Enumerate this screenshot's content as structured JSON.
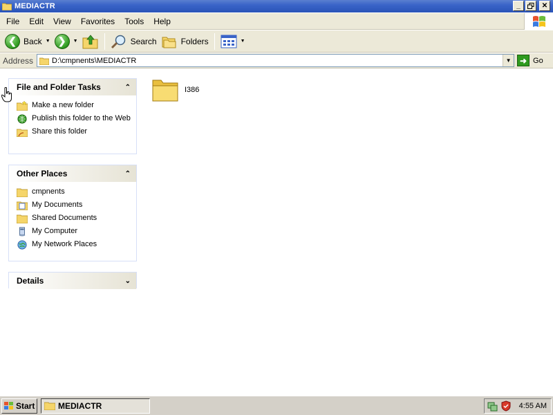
{
  "window": {
    "title": "MEDIACTR",
    "controls": [
      "minimize-icon",
      "restore-icon",
      "close-icon"
    ]
  },
  "menubar": {
    "items": [
      "File",
      "Edit",
      "View",
      "Favorites",
      "Tools",
      "Help"
    ]
  },
  "toolbar": {
    "back_label": "Back",
    "search_label": "Search",
    "folders_label": "Folders"
  },
  "address": {
    "label": "Address",
    "value": "D:\\cmpnents\\MEDIACTR",
    "go_label": "Go"
  },
  "tasks_panel": {
    "title": "File and Folder Tasks",
    "items": [
      {
        "label": "Make a new folder",
        "icon": "new-folder-icon"
      },
      {
        "label": "Publish this folder to the Web",
        "icon": "publish-web-icon"
      },
      {
        "label": "Share this folder",
        "icon": "share-folder-icon"
      }
    ]
  },
  "places_panel": {
    "title": "Other Places",
    "items": [
      {
        "label": "cmpnents",
        "icon": "folder-icon"
      },
      {
        "label": "My Documents",
        "icon": "my-documents-icon"
      },
      {
        "label": "Shared Documents",
        "icon": "folder-icon"
      },
      {
        "label": "My Computer",
        "icon": "my-computer-icon"
      },
      {
        "label": "My Network Places",
        "icon": "network-places-icon"
      }
    ]
  },
  "details_panel": {
    "title": "Details"
  },
  "files": [
    {
      "name": "I386",
      "icon": "folder-icon"
    }
  ],
  "taskbar": {
    "start_label": "Start",
    "task_label": "MEDIACTR",
    "clock": "4:55 AM"
  },
  "colors": {
    "titlebar": "#3a64c8",
    "chrome": "#ece9d8",
    "folder": "#f5d56a"
  }
}
